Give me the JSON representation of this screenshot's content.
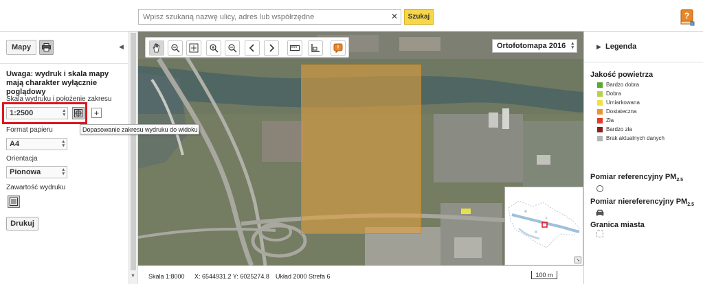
{
  "search": {
    "placeholder": "Wpisz szukaną nazwę ulicy, adres lub współrzędne",
    "value": "",
    "clear_icon": "close-icon",
    "button_label": "Szukaj",
    "accent_color": "#f7d64a"
  },
  "help": {
    "icon": "help-book-icon"
  },
  "left_panel": {
    "mapy_label": "Mapy",
    "print_icon": "printer-icon",
    "collapse_icon": "chevron-left-icon",
    "warning": "Uwaga: wydruk i skala mapy mają charakter wyłącznie poglądowy",
    "scale_label": "Skala wydruku i położenie zakresu",
    "scale_value": "1:2500",
    "fit_tooltip": "Dopasowanie zakresu wydruku do widoku",
    "paper_label": "Format papieru",
    "paper_value": "A4",
    "orientation_label": "Orientacja",
    "orientation_value": "Pionowa",
    "content_label": "Zawartość wydruku",
    "print_button": "Drukuj",
    "highlight_color": "#e0141e"
  },
  "map": {
    "layer": "Ortofotomapa 2016",
    "tools": [
      "pan-hand-icon",
      "zoom-out-box-icon",
      "zoom-extent-icon",
      "zoom-in-icon",
      "zoom-out-icon",
      "previous-view-icon",
      "next-view-icon",
      "measure-distance-icon",
      "measure-area-icon",
      "info-icon"
    ],
    "print_area_color": "#e4a03c"
  },
  "status": {
    "scale": "Skala 1:8000",
    "coords": "X: 6544931.2 Y: 6025274.8",
    "system": "Układ 2000 Strefa 6",
    "scalebar_label": "100 m"
  },
  "legend": {
    "title": "Legenda",
    "air_title": "Jakość powietrza",
    "items": [
      {
        "label": "Bardzo dobra",
        "color": "#5aa832"
      },
      {
        "label": "Dobra",
        "color": "#b4d24a"
      },
      {
        "label": "Umiarkowana",
        "color": "#f2e040"
      },
      {
        "label": "Dostateczna",
        "color": "#e89632"
      },
      {
        "label": "Zła",
        "color": "#e03c28"
      },
      {
        "label": "Bardzo zła",
        "color": "#8c1e1e"
      },
      {
        "label": "Brak aktualnych danych",
        "color": "#b4b4b4"
      }
    ],
    "ref_title": "Pomiar referencyjny PM",
    "ref_sub": "2.5",
    "nonref_title": "Pomiar niereferencyjny PM",
    "nonref_sub": "2.5",
    "city_border": "Granica miasta"
  }
}
